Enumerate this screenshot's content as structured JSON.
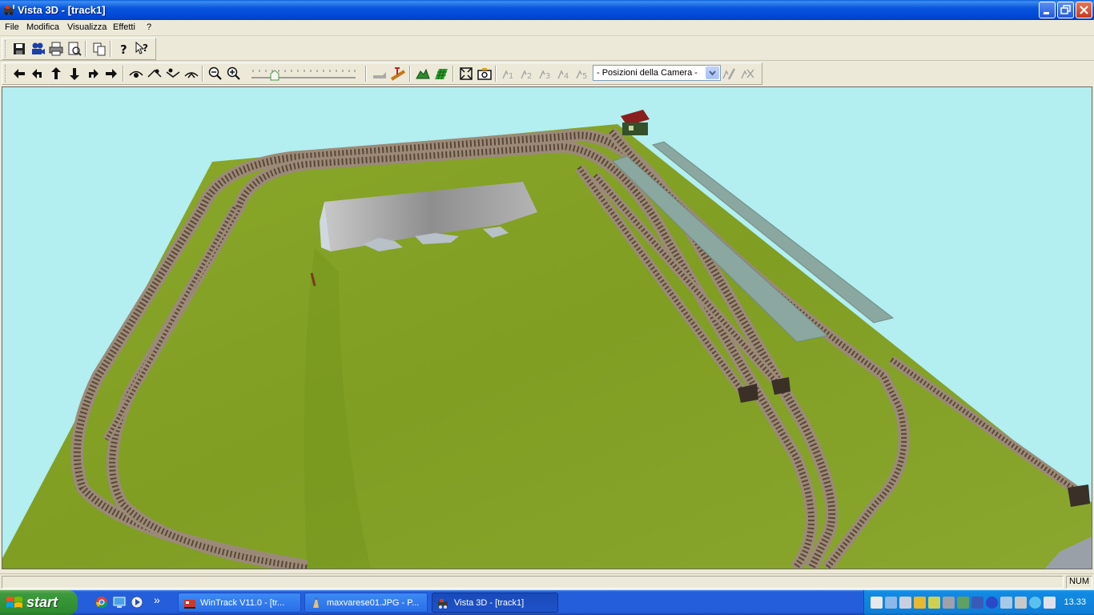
{
  "window": {
    "title": "Vista 3D - [track1]",
    "colors": {
      "titlebar": "#0054e3",
      "close": "#c5391d"
    }
  },
  "menu": {
    "items": [
      "File",
      "Modifica",
      "Visualizza",
      "Effetti",
      "?"
    ]
  },
  "toolbar": {
    "camera_select": {
      "selected": "- Posizioni della Camera -"
    },
    "camera_slots": [
      "1",
      "2",
      "3",
      "4",
      "5"
    ]
  },
  "viewport": {
    "colors": {
      "sky": "#b3eef0",
      "grass": "#8aa62a",
      "track": "#8c7a6a",
      "platform": "#8aa8a0",
      "pit": "#9a9a9a"
    }
  },
  "statusbar": {
    "indicator": "NUM"
  },
  "taskbar": {
    "start_label": "start",
    "tasks": [
      {
        "label": "WinTrack  V11.0 - [tr..."
      },
      {
        "label": "maxvarese01.JPG - P..."
      },
      {
        "label": "Vista 3D - [track1]"
      }
    ],
    "overflow_chevron": "»",
    "clock": "13.33"
  }
}
